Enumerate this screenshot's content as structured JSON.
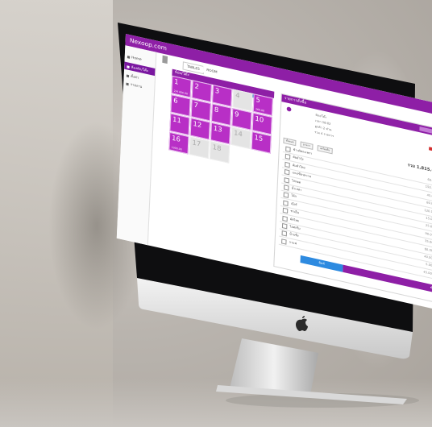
{
  "app": {
    "title": "Nexoop.com"
  },
  "sidebar": {
    "items": [
      {
        "label": "Home"
      },
      {
        "label": "ห้องพัก/โต๊ะ"
      },
      {
        "label": "ตั้งค่า"
      },
      {
        "label": "รายงาน"
      }
    ]
  },
  "tabs": [
    {
      "label": "TABLES"
    },
    {
      "label": "ROOM"
    }
  ],
  "grid": {
    "header": "ห้อง/โต๊ะ",
    "cells": [
      {
        "num": "1",
        "sub": "2/4 400.00",
        "state": "busy"
      },
      {
        "num": "2",
        "sub": "",
        "state": "busy"
      },
      {
        "num": "3",
        "sub": "",
        "state": "busy"
      },
      {
        "num": "4",
        "sub": "",
        "state": "empty"
      },
      {
        "num": "5",
        "sub": "260.00",
        "state": "busy"
      },
      {
        "num": "6",
        "sub": "",
        "state": "busy"
      },
      {
        "num": "7",
        "sub": "",
        "state": "busy"
      },
      {
        "num": "8",
        "sub": "",
        "state": "busy"
      },
      {
        "num": "9",
        "sub": "",
        "state": "busy"
      },
      {
        "num": "10",
        "sub": "",
        "state": "busy"
      },
      {
        "num": "11",
        "sub": "",
        "state": "busy"
      },
      {
        "num": "12",
        "sub": "",
        "state": "busy"
      },
      {
        "num": "13",
        "sub": "",
        "state": "busy"
      },
      {
        "num": "14",
        "sub": "",
        "state": "empty"
      },
      {
        "num": "15",
        "sub": "",
        "state": "busy"
      },
      {
        "num": "16",
        "sub": "1000.00",
        "state": "busy"
      },
      {
        "num": "17",
        "sub": "",
        "state": "empty"
      },
      {
        "num": "18",
        "sub": "",
        "state": "empty"
      }
    ]
  },
  "panel": {
    "title": "รายการสั่งซื้อ",
    "info_lines": [
      "ห้อง/โต๊ะ",
      "เวลา 18:02",
      "ลูกค้า 2 ท่าน",
      "รวม 4 รายการ"
    ],
    "filters": [
      "ทั้งหมด",
      "อาหาร",
      "เครื่องดื่ม"
    ],
    "total_label": "ยอดรวม",
    "total_value": "รวม 1,815.00",
    "rows": [
      {
        "name": "ข้าวผัดกะเพรา",
        "price": "60.00",
        "total": "60.00"
      },
      {
        "name": "ต้มยำกุ้ง",
        "price": "150.00",
        "total": "150.00"
      },
      {
        "name": "ส้มตำไทย",
        "price": "45.00",
        "total": "45.00"
      },
      {
        "name": "แกงเขียวหวาน",
        "price": "80.00",
        "total": "80.00"
      },
      {
        "name": "ไก่ทอด",
        "price": "120.00",
        "total": "120.00"
      },
      {
        "name": "น้ำเปล่า",
        "price": "15.00",
        "total": "30.00"
      },
      {
        "name": "โค้ก",
        "price": "25.00",
        "total": "50.00"
      },
      {
        "name": "เบียร์",
        "price": "90.00",
        "total": "270.00"
      },
      {
        "name": "ชาเย็น",
        "price": "35.00",
        "total": "35.00"
      },
      {
        "name": "ผัดไทย",
        "price": "60.00",
        "total": "60.00"
      },
      {
        "name": "ไอศกรีม",
        "price": "40.00",
        "total": "40.00"
      },
      {
        "name": "น้ำแข็ง",
        "price": "5.00",
        "total": "20.00"
      },
      {
        "name": "กาแฟ",
        "price": "45.00",
        "total": "45.00"
      }
    ],
    "print_button": "พิมพ์",
    "pay_button": "ชำระเงิน"
  },
  "device": {
    "logo": "apple-logo"
  }
}
